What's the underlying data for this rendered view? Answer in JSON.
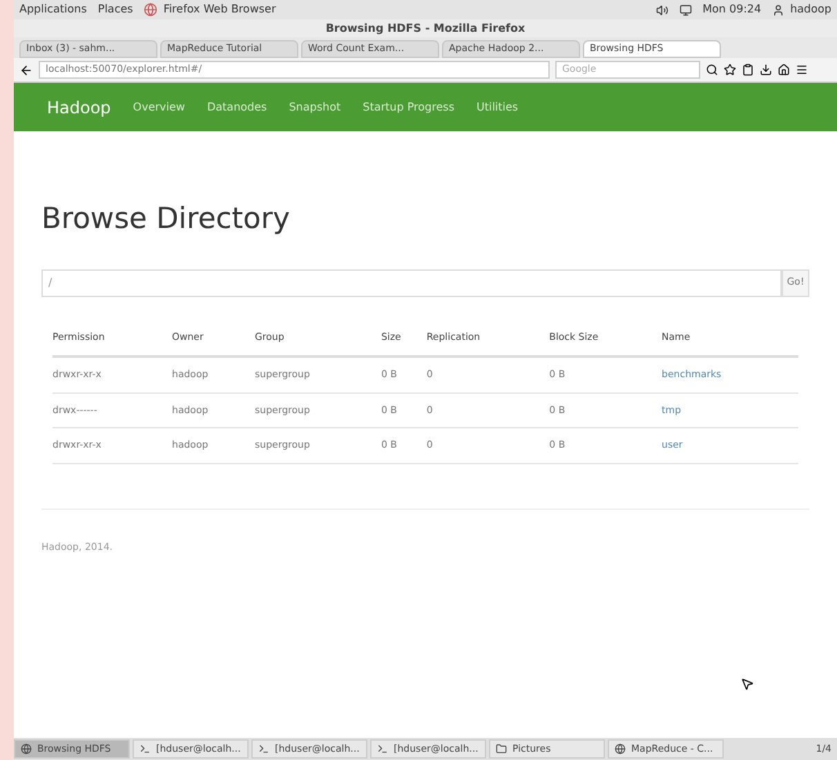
{
  "top_panel": {
    "menus": [
      "Applications",
      "Places"
    ],
    "active_app": "Firefox Web Browser",
    "clock": "Mon 09:24",
    "user": "hadoop"
  },
  "window": {
    "title": "Browsing HDFS - Mozilla Firefox"
  },
  "tabs": [
    {
      "label": "Inbox (3) - sahm...",
      "selected": false
    },
    {
      "label": "MapReduce Tutorial",
      "selected": false
    },
    {
      "label": "Word Count Exam...",
      "selected": false
    },
    {
      "label": "Apache Hadoop 2...",
      "selected": false
    },
    {
      "label": "Browsing HDFS",
      "selected": true
    }
  ],
  "address_bar": {
    "url": "localhost:50070/explorer.html#/"
  },
  "search": {
    "placeholder": "Google"
  },
  "navbar": {
    "brand": "Hadoop",
    "items": [
      "Overview",
      "Datanodes",
      "Snapshot",
      "Startup Progress",
      "Utilities"
    ]
  },
  "page": {
    "heading": "Browse Directory",
    "path": {
      "value": "/"
    },
    "go_button": "Go!"
  },
  "table": {
    "columns": [
      "Permission",
      "Owner",
      "Group",
      "Size",
      "Replication",
      "Block Size",
      "Name"
    ],
    "rows": [
      [
        "drwxr-xr-x",
        "hadoop",
        "supergroup",
        "0 B",
        "0",
        "0 B",
        "benchmarks"
      ],
      [
        "drwx------",
        "hadoop",
        "supergroup",
        "0 B",
        "0",
        "0 B",
        "tmp"
      ],
      [
        "drwxr-xr-x",
        "hadoop",
        "supergroup",
        "0 B",
        "0",
        "0 B",
        "user"
      ]
    ]
  },
  "footer": "Hadoop, 2014.",
  "taskbar": {
    "items": [
      {
        "label": "Browsing HDFS",
        "selected": true
      },
      {
        "label": "[hduser@localh...",
        "selected": false
      },
      {
        "label": "[hduser@localh...",
        "selected": false
      },
      {
        "label": "[hduser@localh...",
        "selected": false
      },
      {
        "label": "Pictures",
        "selected": false
      },
      {
        "label": "MapReduce - C...",
        "selected": false
      }
    ],
    "workspace": "1/4"
  }
}
